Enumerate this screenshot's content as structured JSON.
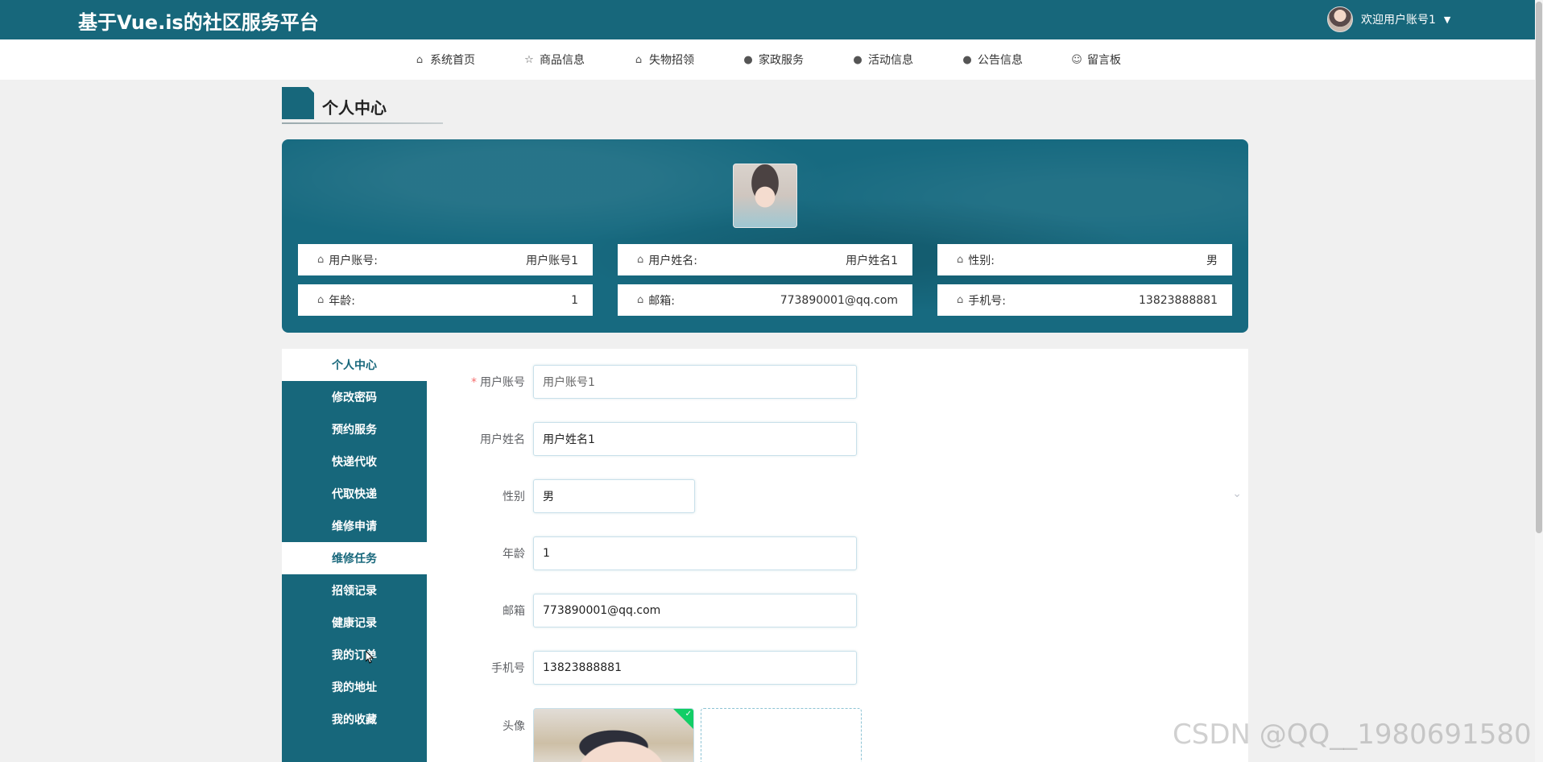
{
  "header": {
    "site_title": "基于Vue.is的社区服务平台",
    "welcome": "欢迎用户账号1",
    "caret": "▼"
  },
  "nav": [
    {
      "label": "系统首页",
      "icon": "home-icon",
      "glyph": "⌂"
    },
    {
      "label": "商品信息",
      "icon": "star-icon",
      "glyph": "☆"
    },
    {
      "label": "失物招领",
      "icon": "bag-icon",
      "glyph": "⌂"
    },
    {
      "label": "家政服务",
      "icon": "alert-circle-icon",
      "glyph": "●"
    },
    {
      "label": "活动信息",
      "icon": "question-circle-icon",
      "glyph": "●"
    },
    {
      "label": "公告信息",
      "icon": "info-circle-icon",
      "glyph": "●"
    },
    {
      "label": "留言板",
      "icon": "smile-icon",
      "glyph": "☺"
    }
  ],
  "page_heading": "个人中心",
  "profile": {
    "fields": [
      {
        "label": "用户账号:",
        "value": "用户账号1"
      },
      {
        "label": "用户姓名:",
        "value": "用户姓名1"
      },
      {
        "label": "性别:",
        "value": "男"
      },
      {
        "label": "年龄:",
        "value": "1"
      },
      {
        "label": "邮箱:",
        "value": "773890001@qq.com"
      },
      {
        "label": "手机号:",
        "value": "13823888881"
      }
    ]
  },
  "side_menu": [
    {
      "label": "个人中心",
      "active": true
    },
    {
      "label": "修改密码",
      "active": false
    },
    {
      "label": "预约服务",
      "active": false
    },
    {
      "label": "快递代收",
      "active": false
    },
    {
      "label": "代取快递",
      "active": false
    },
    {
      "label": "维修申请",
      "active": false
    },
    {
      "label": "维修任务",
      "active": true
    },
    {
      "label": "招领记录",
      "active": false
    },
    {
      "label": "健康记录",
      "active": false
    },
    {
      "label": "我的订单",
      "active": false
    },
    {
      "label": "我的地址",
      "active": false
    },
    {
      "label": "我的收藏",
      "active": false
    }
  ],
  "form": {
    "account": {
      "label": "用户账号",
      "required_mark": "*",
      "value": "用户账号1"
    },
    "name": {
      "label": "用户姓名",
      "value": "用户姓名1"
    },
    "gender": {
      "label": "性别",
      "value": "男"
    },
    "age": {
      "label": "年龄",
      "value": "1"
    },
    "email": {
      "label": "邮箱",
      "value": "773890001@qq.com"
    },
    "phone": {
      "label": "手机号",
      "value": "13823888881"
    },
    "avatar": {
      "label": "头像"
    }
  },
  "watermark": "CSDN @QQ__1980691580",
  "colors": {
    "primary": "#17677b",
    "page_bg": "#f0f0f0",
    "success": "#13ce66",
    "required": "#f56c6c"
  }
}
